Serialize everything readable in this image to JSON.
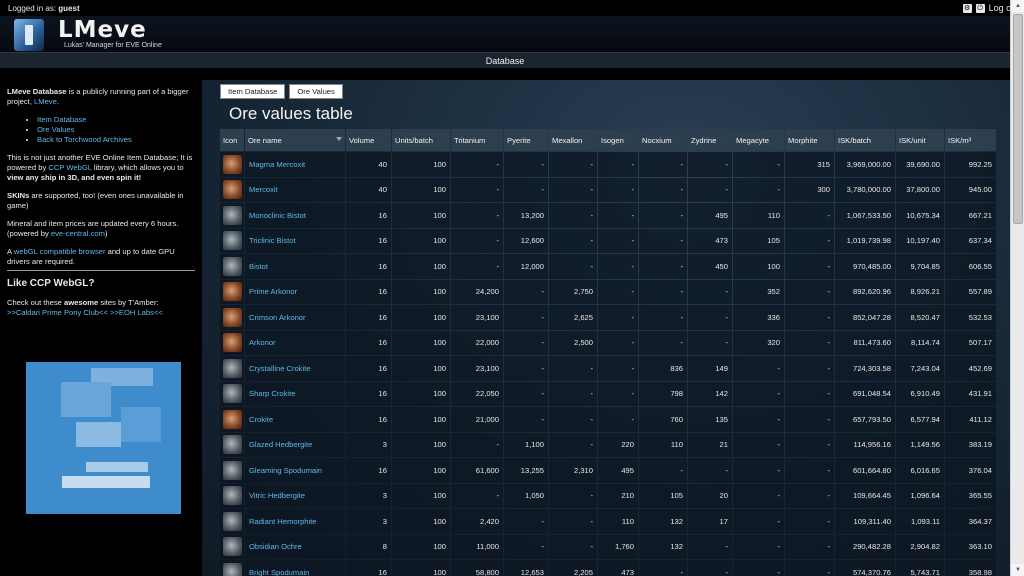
{
  "topbar": {
    "login_prefix": "Logged in as:",
    "username": "guest",
    "logoff_label": "Log off"
  },
  "header": {
    "title": "LMeve",
    "subtitle": "Lukas' Manager for EVE Online",
    "nav_title": "Database"
  },
  "sidebar": {
    "intro_bold": "LMeve Database",
    "intro_text": " is a publicly running part of a bigger project, ",
    "intro_link": "LMeve",
    "links": [
      "Item Database",
      "Ore Values",
      "Back to Torchwood Archives"
    ],
    "webgl_p1": "This is not just another EVE Online Item Database; It is powered by ",
    "webgl_link": "CCP WebGL",
    "webgl_p2": " library, which allows you to ",
    "webgl_bold": "view any ship in 3D, and even spin it!",
    "skins_bold": "SKINs",
    "skins_text": " are supported, too! (even ones unavailable in game)",
    "prices_text": "Mineral and item prices are updated every 6 hours. (powered by ",
    "prices_link": "eve-central.com",
    "prices_end": ")",
    "browser_a": "A ",
    "browser_link": "webGL compatible browser",
    "browser_text": " and up to date GPU drivers are required.",
    "like_heading": "Like CCP WebGL?",
    "checkout_a": "Check out these ",
    "checkout_bold": "awesome",
    "checkout_b": " sites by T'Amber:",
    "site_link_1": ">>Caldari Prime Pony Club<<",
    "site_link_2": ">>EOH Labs<<"
  },
  "tabs": [
    "Item Database",
    "Ore Values"
  ],
  "page_title": "Ore values table",
  "table": {
    "columns": [
      "Icon",
      "Ore name",
      "Volume",
      "Units/batch",
      "Tritanium",
      "Pyerite",
      "Mexallon",
      "Isogen",
      "Nocxium",
      "Zydrine",
      "Megacyte",
      "Morphite",
      "ISK/batch",
      "ISK/unit",
      "ISK/m³"
    ],
    "rows": [
      {
        "icon": "red",
        "cells": [
          "Magma Mercoxit",
          "40",
          "100",
          "-",
          "-",
          "-",
          "-",
          "-",
          "-",
          "-",
          "315",
          "3,969,000.00",
          "39,690.00",
          "992.25"
        ]
      },
      {
        "icon": "red",
        "cells": [
          "Mercoxit",
          "40",
          "100",
          "-",
          "-",
          "-",
          "-",
          "-",
          "-",
          "-",
          "300",
          "3,780,000.00",
          "37,800.00",
          "945.00"
        ]
      },
      {
        "icon": "grey",
        "cells": [
          "Monoclinic Bistot",
          "16",
          "100",
          "-",
          "13,200",
          "-",
          "-",
          "-",
          "495",
          "110",
          "-",
          "1,067,533.50",
          "10,675.34",
          "667.21"
        ]
      },
      {
        "icon": "grey",
        "cells": [
          "Triclinic Bistot",
          "16",
          "100",
          "-",
          "12,600",
          "-",
          "-",
          "-",
          "473",
          "105",
          "-",
          "1,019,739.98",
          "10,197.40",
          "637.34"
        ]
      },
      {
        "icon": "grey",
        "cells": [
          "Bistot",
          "16",
          "100",
          "-",
          "12,000",
          "-",
          "-",
          "-",
          "450",
          "100",
          "-",
          "970,485.00",
          "9,704.85",
          "606.55"
        ]
      },
      {
        "icon": "red",
        "cells": [
          "Prime Arkonor",
          "16",
          "100",
          "24,200",
          "-",
          "2,750",
          "-",
          "-",
          "-",
          "352",
          "-",
          "892,620.96",
          "8,926.21",
          "557.89"
        ]
      },
      {
        "icon": "red",
        "cells": [
          "Crimson Arkonor",
          "16",
          "100",
          "23,100",
          "-",
          "2,625",
          "-",
          "-",
          "-",
          "336",
          "-",
          "852,047.28",
          "8,520.47",
          "532.53"
        ]
      },
      {
        "icon": "red",
        "cells": [
          "Arkonor",
          "16",
          "100",
          "22,000",
          "-",
          "2,500",
          "-",
          "-",
          "-",
          "320",
          "-",
          "811,473.60",
          "8,114.74",
          "507.17"
        ]
      },
      {
        "icon": "grey",
        "cells": [
          "Crystalline Crokite",
          "16",
          "100",
          "23,100",
          "-",
          "-",
          "-",
          "836",
          "149",
          "-",
          "-",
          "724,303.58",
          "7,243.04",
          "452.69"
        ]
      },
      {
        "icon": "grey",
        "cells": [
          "Sharp Crokite",
          "16",
          "100",
          "22,050",
          "-",
          "-",
          "-",
          "798",
          "142",
          "-",
          "-",
          "691,048.54",
          "6,910.49",
          "431.91"
        ]
      },
      {
        "icon": "red",
        "cells": [
          "Crokite",
          "16",
          "100",
          "21,000",
          "-",
          "-",
          "-",
          "760",
          "135",
          "-",
          "-",
          "657,793.50",
          "6,577.94",
          "411.12"
        ]
      },
      {
        "icon": "grey",
        "cells": [
          "Glazed Hedbergite",
          "3",
          "100",
          "-",
          "1,100",
          "-",
          "220",
          "110",
          "21",
          "-",
          "-",
          "114,956.16",
          "1,149.56",
          "383.19"
        ]
      },
      {
        "icon": "grey",
        "cells": [
          "Gleaming Spodumain",
          "16",
          "100",
          "61,600",
          "13,255",
          "2,310",
          "495",
          "-",
          "-",
          "-",
          "-",
          "601,664.80",
          "6,016.65",
          "376.04"
        ]
      },
      {
        "icon": "grey",
        "cells": [
          "Vitric Hedbergite",
          "3",
          "100",
          "-",
          "1,050",
          "-",
          "210",
          "105",
          "20",
          "-",
          "-",
          "109,664.45",
          "1,096.64",
          "365.55"
        ]
      },
      {
        "icon": "grey",
        "cells": [
          "Radiant Hemorphite",
          "3",
          "100",
          "2,420",
          "-",
          "-",
          "110",
          "132",
          "17",
          "-",
          "-",
          "109,311.40",
          "1,093.11",
          "364.37"
        ]
      },
      {
        "icon": "grey",
        "cells": [
          "Obsidian Ochre",
          "8",
          "100",
          "11,000",
          "-",
          "-",
          "1,760",
          "132",
          "-",
          "-",
          "-",
          "290,482.28",
          "2,904.82",
          "363.10"
        ]
      },
      {
        "icon": "grey",
        "cells": [
          "Bright Spodumain",
          "16",
          "100",
          "58,800",
          "12,653",
          "2,205",
          "473",
          "-",
          "-",
          "-",
          "-",
          "574,370.76",
          "5,743.71",
          "358.98"
        ]
      }
    ]
  }
}
